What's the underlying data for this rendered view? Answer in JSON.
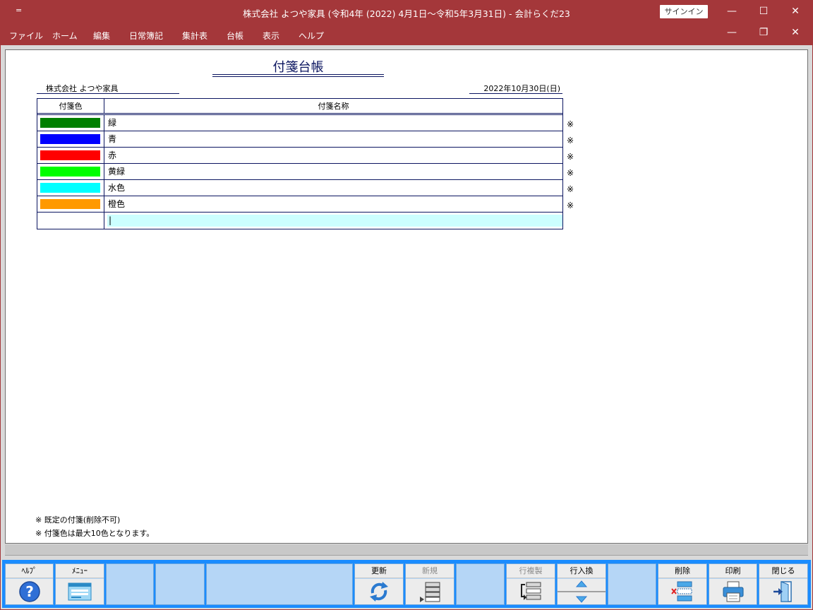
{
  "window": {
    "quick_access": "=",
    "title": "株式会社 よつや家具 (令和4年 (2022) 4月1日～令和5年3月31日) - 会計らくだ23",
    "signin_label": "サインイン",
    "minimize": "—",
    "maximize": "☐",
    "close": "✕",
    "restore": "❐"
  },
  "menu": {
    "items": [
      "ファイル",
      "ホーム",
      "編集",
      "日常簿記",
      "集計表",
      "台帳",
      "表示",
      "ヘルプ"
    ]
  },
  "document": {
    "title": "付箋台帳",
    "company": "株式会社 よつや家具",
    "date": "2022年10月30日(日)",
    "columns": {
      "color": "付箋色",
      "name": "付箋名称"
    },
    "rows": [
      {
        "name": "緑",
        "color": "#008000",
        "mark": "※"
      },
      {
        "name": "青",
        "color": "#0000ff",
        "mark": "※"
      },
      {
        "name": "赤",
        "color": "#ff0000",
        "mark": "※"
      },
      {
        "name": "黄緑",
        "color": "#00ff00",
        "mark": "※"
      },
      {
        "name": "水色",
        "color": "#00ffff",
        "mark": "※"
      },
      {
        "name": "橙色",
        "color": "#ff9900",
        "mark": "※"
      }
    ],
    "new_row_value": "|",
    "notes": [
      "※ 既定の付箋(削除不可)",
      "※ 付箋色は最大10色となります。"
    ]
  },
  "fkeys": {
    "help": {
      "label": "ﾍﾙﾌﾟ",
      "icon": "help-icon"
    },
    "menu": {
      "label": "ﾒﾆｭｰ",
      "icon": "menu-icon"
    },
    "update": {
      "label": "更新",
      "icon": "refresh-icon"
    },
    "new": {
      "label": "新規",
      "icon": "new-row-icon"
    },
    "copy_row": {
      "label": "行複製",
      "icon": "copy-row-icon"
    },
    "swap_row": {
      "label": "行入換",
      "icon": "swap-row-icon"
    },
    "delete": {
      "label": "削除",
      "icon": "delete-row-icon"
    },
    "print": {
      "label": "印刷",
      "icon": "printer-icon"
    },
    "close": {
      "label": "閉じる",
      "icon": "exit-door-icon"
    }
  }
}
